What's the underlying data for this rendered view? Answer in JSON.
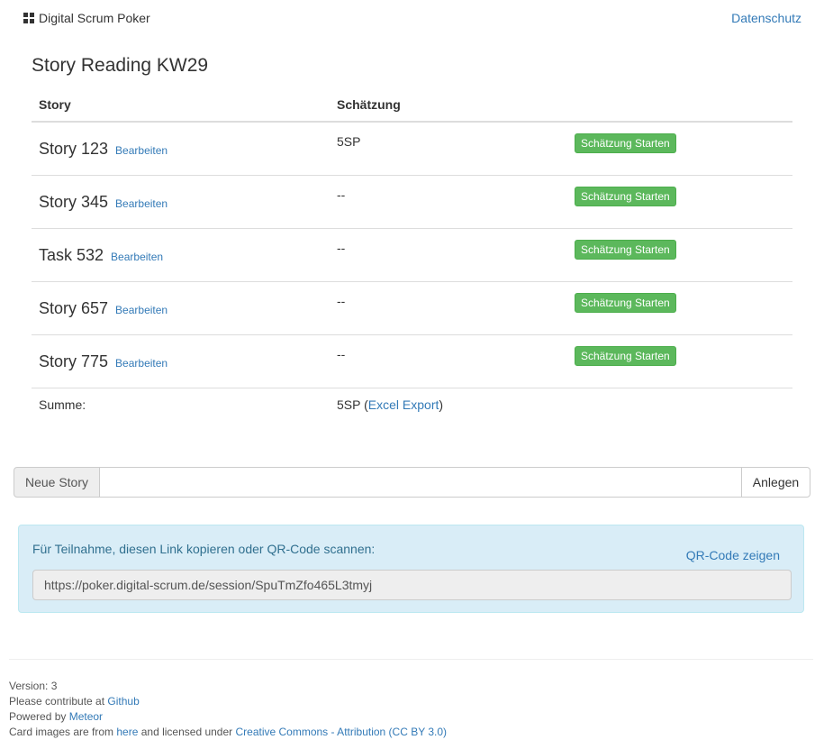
{
  "navbar": {
    "brand": "Digital Scrum Poker",
    "brand_icon": "grid-icon",
    "privacy_link": "Datenschutz"
  },
  "session": {
    "title": "Story Reading KW29"
  },
  "table": {
    "headers": [
      "Story",
      "Schätzung"
    ],
    "rows": [
      {
        "name": "Story 123",
        "edit": "Bearbeiten",
        "estimate": "5SP",
        "action": "Schätzung Starten"
      },
      {
        "name": "Story 345",
        "edit": "Bearbeiten",
        "estimate": "--",
        "action": "Schätzung Starten"
      },
      {
        "name": "Task 532",
        "edit": "Bearbeiten",
        "estimate": "--",
        "action": "Schätzung Starten"
      },
      {
        "name": "Story 657",
        "edit": "Bearbeiten",
        "estimate": "--",
        "action": "Schätzung Starten"
      },
      {
        "name": "Story 775",
        "edit": "Bearbeiten",
        "estimate": "--",
        "action": "Schätzung Starten"
      }
    ],
    "sum_label": "Summe:",
    "sum_value": "5SP",
    "sum_open": " (",
    "export_link": "Excel Export",
    "sum_close": ")"
  },
  "new_story": {
    "label": "Neue Story",
    "value": "",
    "button": "Anlegen"
  },
  "share": {
    "text": "Für Teilnahme, diesen Link kopieren oder QR-Code scannen:",
    "qr_link": "QR-Code zeigen",
    "url": "https://poker.digital-scrum.de/session/SpuTmZfo465L3tmyj"
  },
  "footer": {
    "version": "Version: 3",
    "contribute_prefix": "Please contribute at ",
    "contribute_link": "Github",
    "powered_prefix": "Powered by ",
    "powered_link": "Meteor",
    "cards_prefix": "Card images are from ",
    "cards_here": "here",
    "cards_middle": " and licensed under ",
    "cards_license": "Creative Commons - Attribution (CC BY 3.0)"
  },
  "colors": {
    "link": "#337ab7",
    "success": "#5cb85c",
    "info_bg": "#d9edf7",
    "info_text": "#31708f"
  }
}
